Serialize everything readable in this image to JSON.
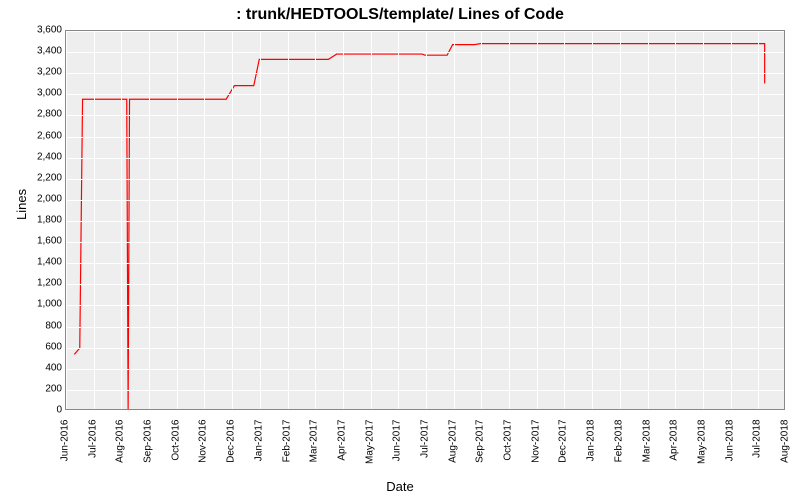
{
  "chart_data": {
    "type": "line",
    "title": ": trunk/HEDTOOLS/template/ Lines of Code",
    "xlabel": "Date",
    "ylabel": "Lines",
    "ylim": [
      0,
      3600
    ],
    "xlim": [
      "Jun-2016",
      "Aug-2018"
    ],
    "yticks": [
      0,
      200,
      400,
      600,
      800,
      1000,
      1200,
      1400,
      1600,
      1800,
      2000,
      2200,
      2400,
      2600,
      2800,
      3000,
      3200,
      3400,
      3600
    ],
    "xticks": [
      "Jun-2016",
      "Jul-2016",
      "Aug-2016",
      "Sep-2016",
      "Oct-2016",
      "Nov-2016",
      "Dec-2016",
      "Jan-2017",
      "Feb-2017",
      "Mar-2017",
      "Apr-2017",
      "May-2017",
      "Jun-2017",
      "Jul-2017",
      "Aug-2017",
      "Sep-2017",
      "Oct-2017",
      "Nov-2017",
      "Dec-2017",
      "Jan-2018",
      "Feb-2018",
      "Mar-2018",
      "Apr-2018",
      "May-2018",
      "Jun-2018",
      "Jul-2018",
      "Aug-2018"
    ],
    "series": [
      {
        "name": "Lines of Code",
        "color": "#ff0000",
        "points": [
          {
            "x": 0.3,
            "y": 520
          },
          {
            "x": 0.5,
            "y": 580
          },
          {
            "x": 0.6,
            "y": 2950
          },
          {
            "x": 2.2,
            "y": 2950
          },
          {
            "x": 2.25,
            "y": 0
          },
          {
            "x": 2.3,
            "y": 2950
          },
          {
            "x": 5.8,
            "y": 2950
          },
          {
            "x": 6.1,
            "y": 3080
          },
          {
            "x": 6.8,
            "y": 3080
          },
          {
            "x": 7.0,
            "y": 3330
          },
          {
            "x": 9.5,
            "y": 3330
          },
          {
            "x": 9.8,
            "y": 3380
          },
          {
            "x": 12.9,
            "y": 3380
          },
          {
            "x": 13.0,
            "y": 3370
          },
          {
            "x": 13.8,
            "y": 3370
          },
          {
            "x": 14.0,
            "y": 3470
          },
          {
            "x": 14.8,
            "y": 3470
          },
          {
            "x": 15.0,
            "y": 3480
          },
          {
            "x": 25.3,
            "y": 3480
          },
          {
            "x": 25.3,
            "y": 3100
          }
        ]
      }
    ]
  }
}
